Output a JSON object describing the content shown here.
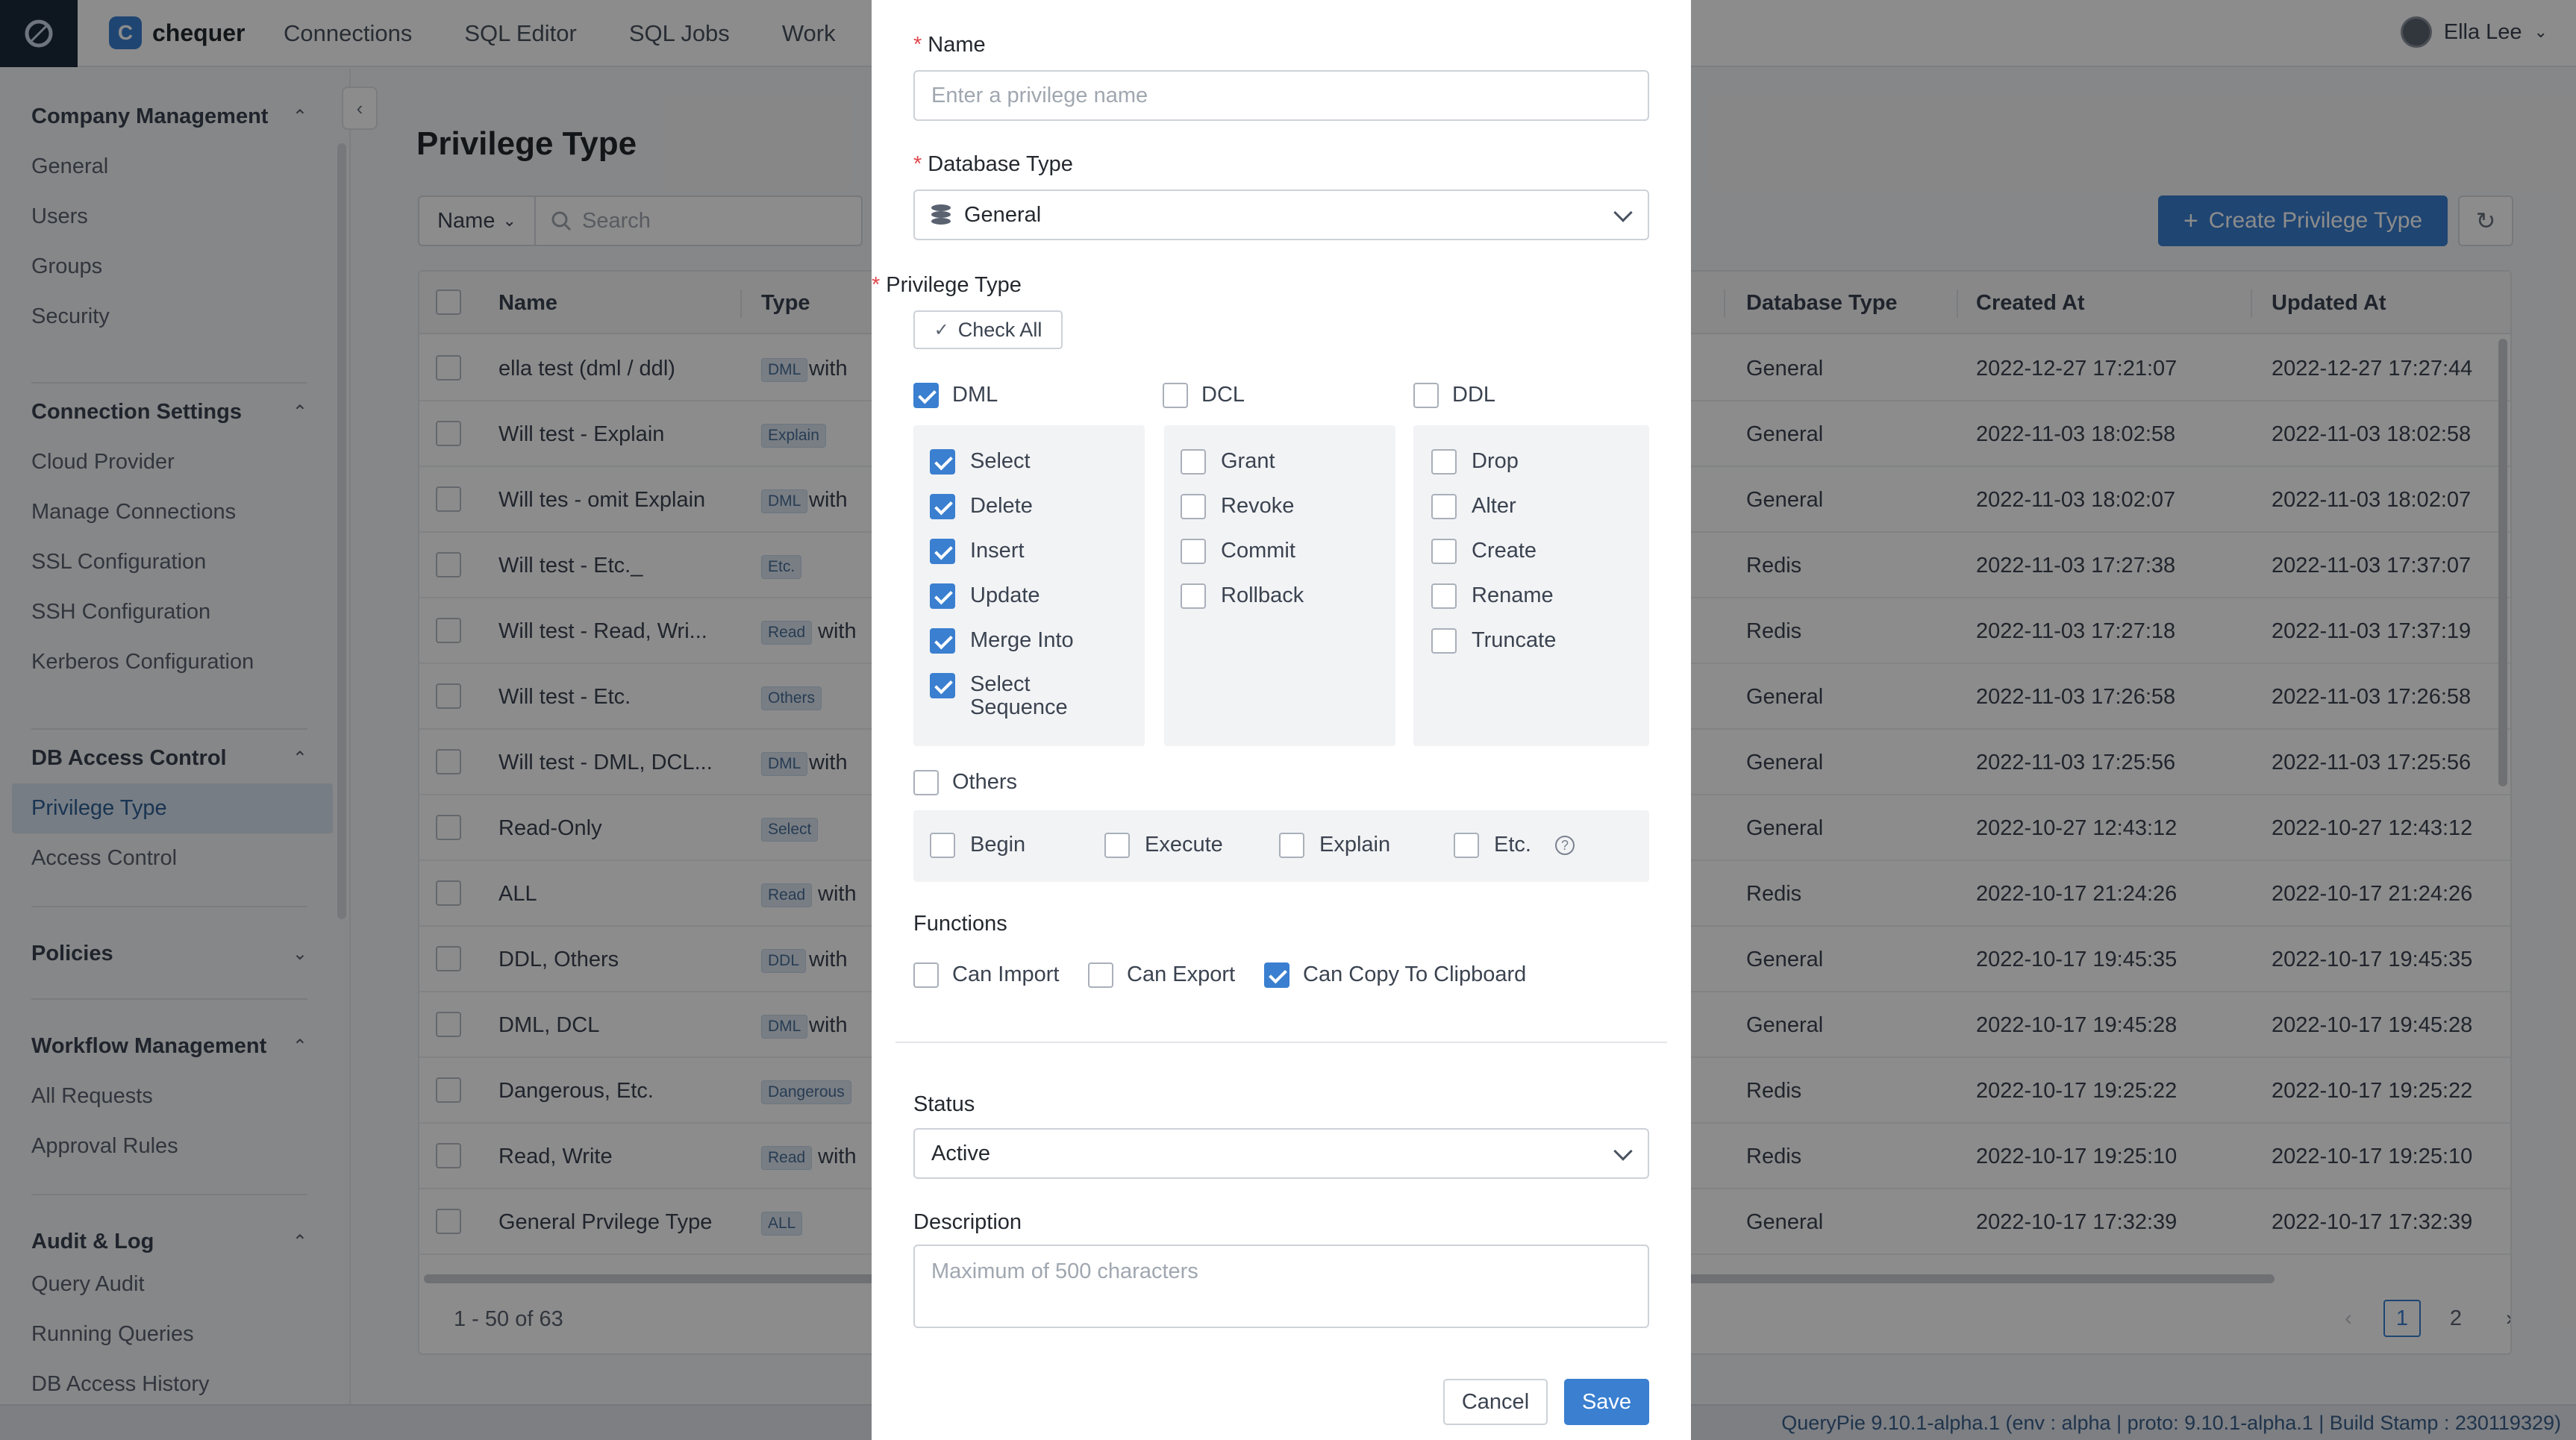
{
  "header": {
    "brand": "chequer",
    "brand_initial": "C",
    "nav": [
      "Connections",
      "SQL Editor",
      "SQL Jobs",
      "Work"
    ],
    "user": "Ella Lee"
  },
  "sidebar": {
    "sections": [
      {
        "title": "Company Management",
        "items": [
          "General",
          "Users",
          "Groups",
          "Security"
        ]
      },
      {
        "title": "Connection Settings",
        "items": [
          "Cloud Provider",
          "Manage Connections",
          "SSL Configuration",
          "SSH Configuration",
          "Kerberos Configuration"
        ]
      },
      {
        "title": "DB Access Control",
        "items": [
          "Privilege Type",
          "Access Control"
        ]
      },
      {
        "title": "Policies",
        "items": []
      },
      {
        "title": "Workflow Management",
        "items": [
          "All Requests",
          "Approval Rules"
        ]
      },
      {
        "title": "Audit & Log",
        "items": [
          "Query Audit",
          "Running Queries",
          "DB Access History"
        ]
      }
    ],
    "active_item": "Privilege Type"
  },
  "main": {
    "title": "Privilege Type",
    "filter_field": "Name",
    "search_placeholder": "Search",
    "create_button": "Create Privilege Type",
    "columns": {
      "name": "Name",
      "type": "Type",
      "db_type": "Database Type",
      "created": "Created At",
      "updated": "Updated At"
    },
    "rows": [
      {
        "name": "ella test (dml / ddl)",
        "tag": "DML",
        "extra": "with",
        "db": "General",
        "created": "2022-12-27 17:21:07",
        "updated": "2022-12-27 17:27:44"
      },
      {
        "name": "Will test - Explain",
        "tag": "Explain",
        "extra": "",
        "db": "General",
        "created": "2022-11-03 18:02:58",
        "updated": "2022-11-03 18:02:58"
      },
      {
        "name": "Will tes - omit Explain",
        "tag": "DML",
        "extra": "with",
        "db": "General",
        "created": "2022-11-03 18:02:07",
        "updated": "2022-11-03 18:02:07"
      },
      {
        "name": "Will test - Etc._",
        "tag": "Etc.",
        "extra": "",
        "db": "Redis",
        "created": "2022-11-03 17:27:38",
        "updated": "2022-11-03 17:37:07"
      },
      {
        "name": "Will test - Read, Wri...",
        "tag": "Read",
        "extra": "with",
        "db": "Redis",
        "created": "2022-11-03 17:27:18",
        "updated": "2022-11-03 17:37:19"
      },
      {
        "name": "Will test - Etc.",
        "tag": "Others",
        "extra": "",
        "db": "General",
        "created": "2022-11-03 17:26:58",
        "updated": "2022-11-03 17:26:58"
      },
      {
        "name": "Will test - DML, DCL...",
        "tag": "DML",
        "extra": "with",
        "db": "General",
        "created": "2022-11-03 17:25:56",
        "updated": "2022-11-03 17:25:56"
      },
      {
        "name": "Read-Only",
        "tag": "Select",
        "extra": "",
        "db": "General",
        "created": "2022-10-27 12:43:12",
        "updated": "2022-10-27 12:43:12"
      },
      {
        "name": "ALL",
        "tag": "Read",
        "extra": "with",
        "db": "Redis",
        "created": "2022-10-17 21:24:26",
        "updated": "2022-10-17 21:24:26"
      },
      {
        "name": "DDL, Others",
        "tag": "DDL",
        "extra": "with",
        "db": "General",
        "created": "2022-10-17 19:45:35",
        "updated": "2022-10-17 19:45:35"
      },
      {
        "name": "DML, DCL",
        "tag": "DML",
        "extra": "with",
        "db": "General",
        "created": "2022-10-17 19:45:28",
        "updated": "2022-10-17 19:45:28"
      },
      {
        "name": "Dangerous, Etc.",
        "tag": "Dangerous",
        "extra": "",
        "db": "Redis",
        "created": "2022-10-17 19:25:22",
        "updated": "2022-10-17 19:25:22"
      },
      {
        "name": "Read, Write",
        "tag": "Read",
        "extra": "with",
        "db": "Redis",
        "created": "2022-10-17 19:25:10",
        "updated": "2022-10-17 19:25:10"
      },
      {
        "name": "General Prvilege Type",
        "tag": "ALL",
        "extra": "",
        "db": "General",
        "created": "2022-10-17 17:32:39",
        "updated": "2022-10-17 17:32:39"
      }
    ],
    "range_info": "1 - 50 of 63",
    "pages": [
      "1",
      "2"
    ],
    "current_page": "1"
  },
  "status_bar": "QueryPie 9.10.1-alpha.1 (env : alpha | proto: 9.10.1-alpha.1 | Build Stamp : 230119329)",
  "modal": {
    "name_label": "Name",
    "name_placeholder": "Enter a privilege name",
    "db_type_label": "Database Type",
    "db_type_value": "General",
    "privilege_label": "Privilege Type",
    "check_all": "Check All",
    "groups": {
      "dml": {
        "label": "DML",
        "checked": true,
        "items": [
          {
            "label": "Select",
            "checked": true
          },
          {
            "label": "Delete",
            "checked": true
          },
          {
            "label": "Insert",
            "checked": true
          },
          {
            "label": "Update",
            "checked": true
          },
          {
            "label": "Merge Into",
            "checked": true
          },
          {
            "label": "Select Sequence",
            "checked": true
          }
        ]
      },
      "dcl": {
        "label": "DCL",
        "checked": false,
        "items": [
          {
            "label": "Grant",
            "checked": false
          },
          {
            "label": "Revoke",
            "checked": false
          },
          {
            "label": "Commit",
            "checked": false
          },
          {
            "label": "Rollback",
            "checked": false
          }
        ]
      },
      "ddl": {
        "label": "DDL",
        "checked": false,
        "items": [
          {
            "label": "Drop",
            "checked": false
          },
          {
            "label": "Alter",
            "checked": false
          },
          {
            "label": "Create",
            "checked": false
          },
          {
            "label": "Rename",
            "checked": false
          },
          {
            "label": "Truncate",
            "checked": false
          }
        ]
      },
      "others": {
        "label": "Others",
        "checked": false,
        "items": [
          {
            "label": "Begin",
            "checked": false
          },
          {
            "label": "Execute",
            "checked": false
          },
          {
            "label": "Explain",
            "checked": false
          },
          {
            "label": "Etc.",
            "checked": false
          }
        ]
      }
    },
    "functions_label": "Functions",
    "functions": [
      {
        "label": "Can Import",
        "checked": false
      },
      {
        "label": "Can Export",
        "checked": false
      },
      {
        "label": "Can Copy To Clipboard",
        "checked": true
      }
    ],
    "status_label": "Status",
    "status_value": "Active",
    "description_label": "Description",
    "description_placeholder": "Maximum of 500 characters",
    "cancel": "Cancel",
    "save": "Save"
  }
}
